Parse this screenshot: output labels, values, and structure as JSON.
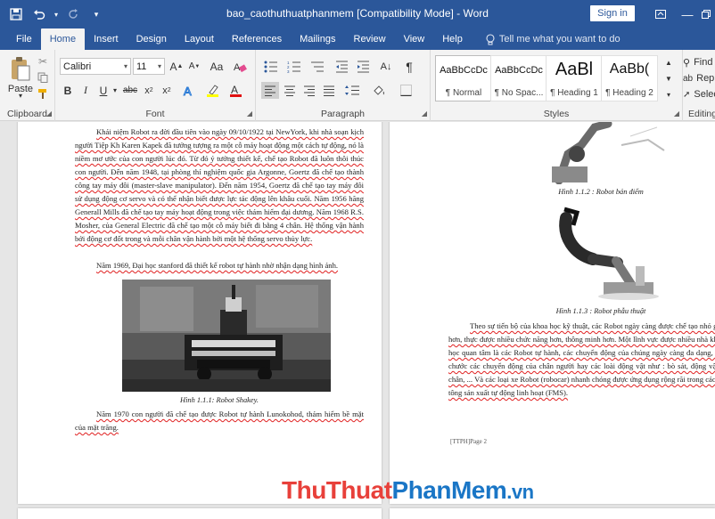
{
  "window": {
    "title": "bao_caothuthuatphanmem [Compatibility Mode]  -  Word",
    "sign_in": "Sign in"
  },
  "colors": {
    "accent": "#2b579a",
    "ribbon_bg": "#f3f3f3",
    "watermark_red": "#e8403a",
    "watermark_blue": "#1a76c6"
  },
  "tabs": [
    "File",
    "Home",
    "Insert",
    "Design",
    "Layout",
    "References",
    "Mailings",
    "Review",
    "View",
    "Help"
  ],
  "tell_me": "Tell me what you want to do",
  "ribbon": {
    "clipboard": {
      "paste": "Paste",
      "label": "Clipboard"
    },
    "font": {
      "name": "Calibri",
      "size": "11",
      "label": "Font"
    },
    "paragraph": {
      "label": "Paragraph"
    },
    "styles": {
      "label": "Styles",
      "items": [
        {
          "sample": "AaBbCcDc",
          "name": "¶ Normal"
        },
        {
          "sample": "AaBbCcDc",
          "name": "¶ No Spac..."
        },
        {
          "sample": "AaBl",
          "name": "¶ Heading 1"
        },
        {
          "sample": "AaBb(",
          "name": "¶ Heading 2"
        }
      ]
    },
    "editing": {
      "find": "Find",
      "replace": "Repla",
      "select": "Select",
      "label": "Editing"
    }
  },
  "page1": {
    "paragraphs": [
      "Khái niệm Robot ra đời đầu tiên vào ngày 09/10/1922 tại NewYork, khi nhà soạn kịch người Tiệp Kh Karen Kapek đã tưởng tượng ra một cỗ máy hoạt động một cách tự động, nó là niềm mơ ước của con người lúc đó. Từ đó ý tưởng thiết kế, chế tạo Robot đã luôn thôi thúc con người. Đến năm 1948, tại phòng thí nghiệm quốc gia Argonne, Goertz đã chế tạo thành công tay máy đôi (master-slave manipulator). Đến năm 1954, Goertz đã chế tạo tay máy đôi sử dụng động cơ servo và có thể nhận biết được lực tác động lên khâu cuối. Năm 1956 hãng Generall Mills đã chế tạo tay máy hoạt động trong việc thám hiểm đại dương. Năm 1968 R.S. Mosher, của General Electric đã chế tạo một cỗ máy biết đi bằng 4 chân. Hệ thống vận hành bởi động cơ đốt trong và mỗi chân vận hành bởi một hệ thống servo thủy lực.",
      "Năm 1969, Đại học stanford đã thiết kế robot tự hành nhờ nhận dạng hình ảnh.",
      "Năm 1970 con người đã chế tạo được Robot tự hành Lunokohod, thám hiểm bề mặt của mặt trăng."
    ],
    "caption": "Hình 1.1.1: Robot Shakey."
  },
  "page2": {
    "captions": [
      "Hình 1.1.2 : Robot bán điểm",
      "Hình 1.1.3 : Robot phẫu thuật"
    ],
    "paragraph": "Theo sự tiến bộ của khoa học kỹ thuật, các Robot ngày càng được chế tạo nhỏ gọn hơn, thực được nhiều chức năng hơn, thông minh hơn. Một lĩnh vực được nhiều nhà khoa học quan tâm là các Robot tự hành, các chuyển động của chúng ngày càng đa dạng, bắt chước các chuyển động của chân người hay các loài động vật như : bò sát, động vật 4 chân, ... Và các loại xe Robot (robocar) nhanh chóng được ứng dụng rộng rãi trong các bê tông sản xuất tự động linh hoạt (FMS).",
    "footer": "[TTPH]Page 2"
  },
  "watermark": {
    "red": "ThuThuat",
    "blue": "PhanMem",
    "tail": ".vn"
  }
}
